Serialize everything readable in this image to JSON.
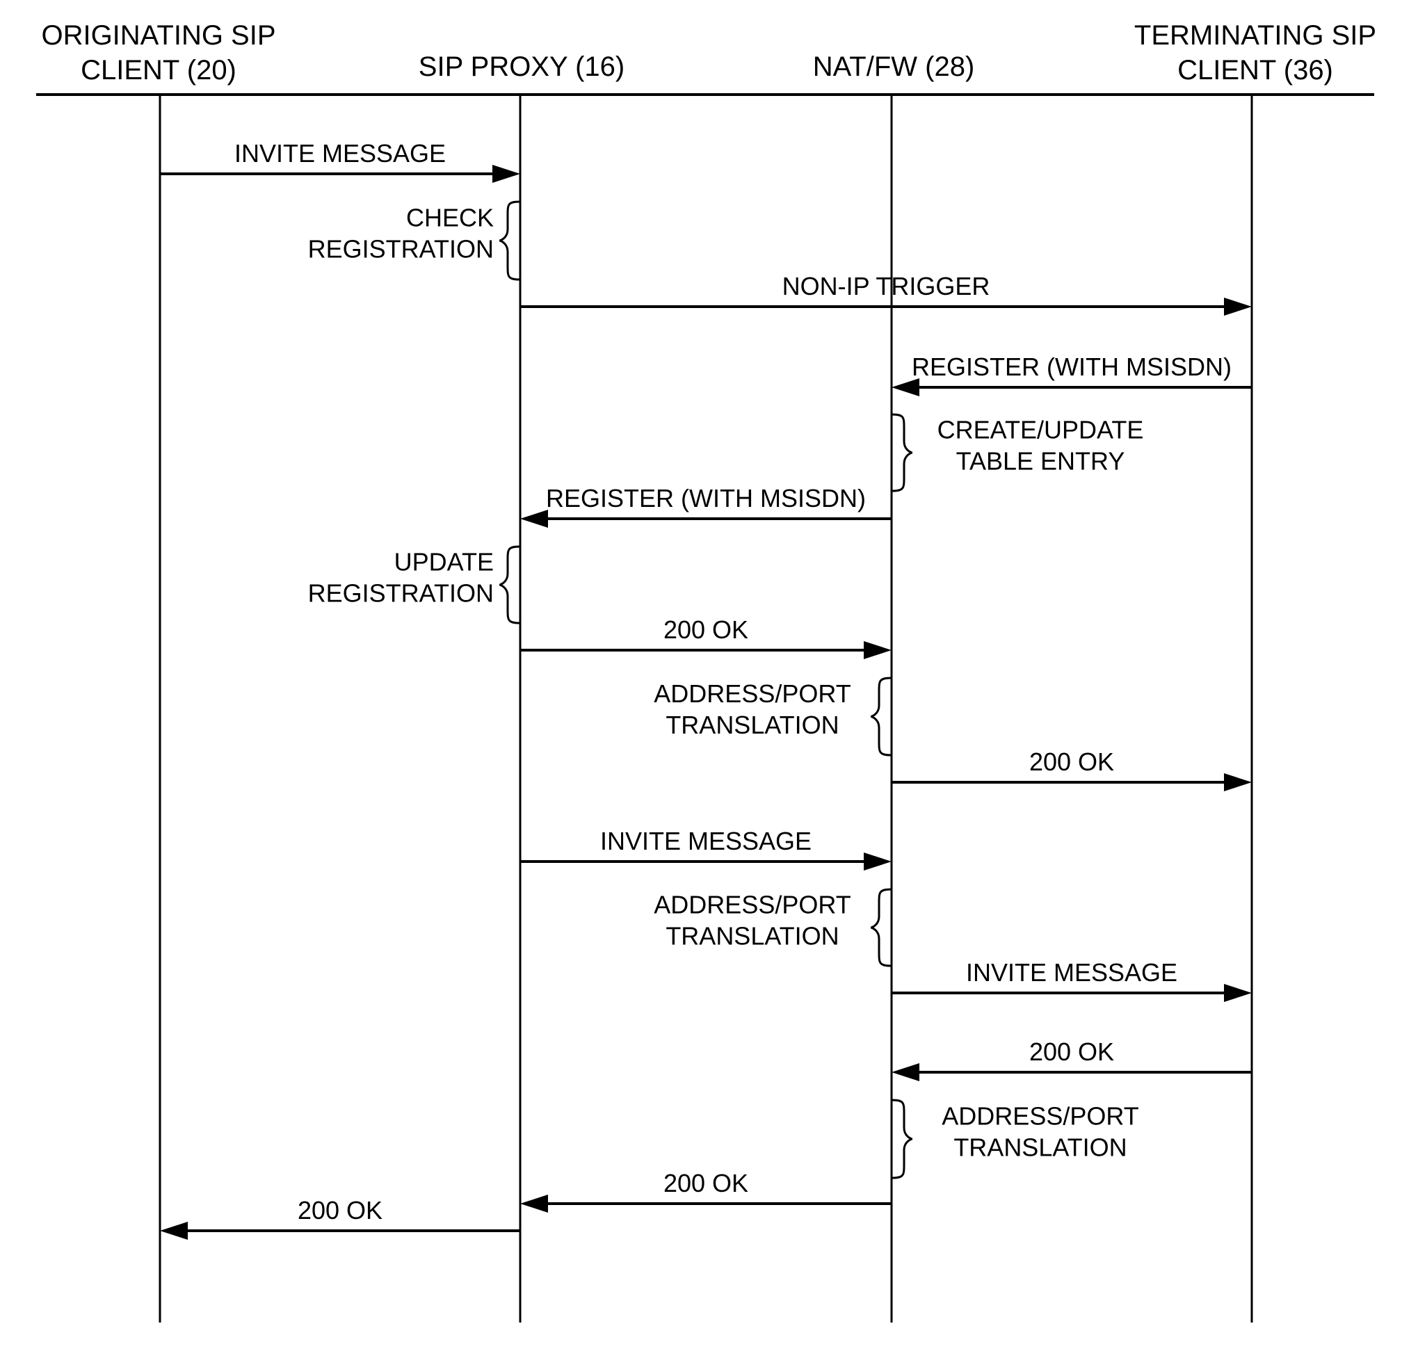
{
  "diagram": {
    "type": "sequence",
    "colors": {
      "ink": "#000000",
      "background": "#ffffff"
    },
    "participants": [
      {
        "id": "orig",
        "lines": [
          "ORIGINATING SIP",
          "CLIENT (20)"
        ]
      },
      {
        "id": "proxy",
        "lines": [
          "SIP PROXY (16)"
        ]
      },
      {
        "id": "nat",
        "lines": [
          "NAT/FW (28)"
        ]
      },
      {
        "id": "term",
        "lines": [
          "TERMINATING SIP",
          "CLIENT (36)"
        ]
      }
    ],
    "steps": [
      {
        "kind": "message",
        "from": "orig",
        "to": "proxy",
        "label": "INVITE MESSAGE"
      },
      {
        "kind": "process",
        "at": "proxy",
        "side": "left",
        "lines": [
          "CHECK",
          "REGISTRATION"
        ]
      },
      {
        "kind": "message",
        "from": "proxy",
        "to": "term",
        "label": "NON-IP TRIGGER"
      },
      {
        "kind": "message",
        "from": "term",
        "to": "nat",
        "label": "REGISTER (WITH MSISDN)"
      },
      {
        "kind": "process",
        "at": "nat",
        "side": "right",
        "lines": [
          "CREATE/UPDATE",
          "TABLE ENTRY"
        ]
      },
      {
        "kind": "message",
        "from": "nat",
        "to": "proxy",
        "label": "REGISTER (WITH MSISDN)"
      },
      {
        "kind": "process",
        "at": "proxy",
        "side": "left",
        "lines": [
          "UPDATE",
          "REGISTRATION"
        ]
      },
      {
        "kind": "message",
        "from": "proxy",
        "to": "nat",
        "label": "200 OK"
      },
      {
        "kind": "process",
        "at": "nat",
        "side": "left",
        "lines": [
          "ADDRESS/PORT",
          "TRANSLATION"
        ]
      },
      {
        "kind": "message",
        "from": "nat",
        "to": "term",
        "label": "200 OK"
      },
      {
        "kind": "message",
        "from": "proxy",
        "to": "nat",
        "label": "INVITE MESSAGE"
      },
      {
        "kind": "process",
        "at": "nat",
        "side": "left",
        "lines": [
          "ADDRESS/PORT",
          "TRANSLATION"
        ]
      },
      {
        "kind": "message",
        "from": "nat",
        "to": "term",
        "label": "INVITE MESSAGE"
      },
      {
        "kind": "message",
        "from": "term",
        "to": "nat",
        "label": "200  OK"
      },
      {
        "kind": "process",
        "at": "nat",
        "side": "right",
        "lines": [
          "ADDRESS/PORT",
          "TRANSLATION"
        ]
      },
      {
        "kind": "message",
        "from": "nat",
        "to": "proxy",
        "label": "200  OK"
      },
      {
        "kind": "message",
        "from": "proxy",
        "to": "orig",
        "label": "200  OK"
      }
    ]
  }
}
